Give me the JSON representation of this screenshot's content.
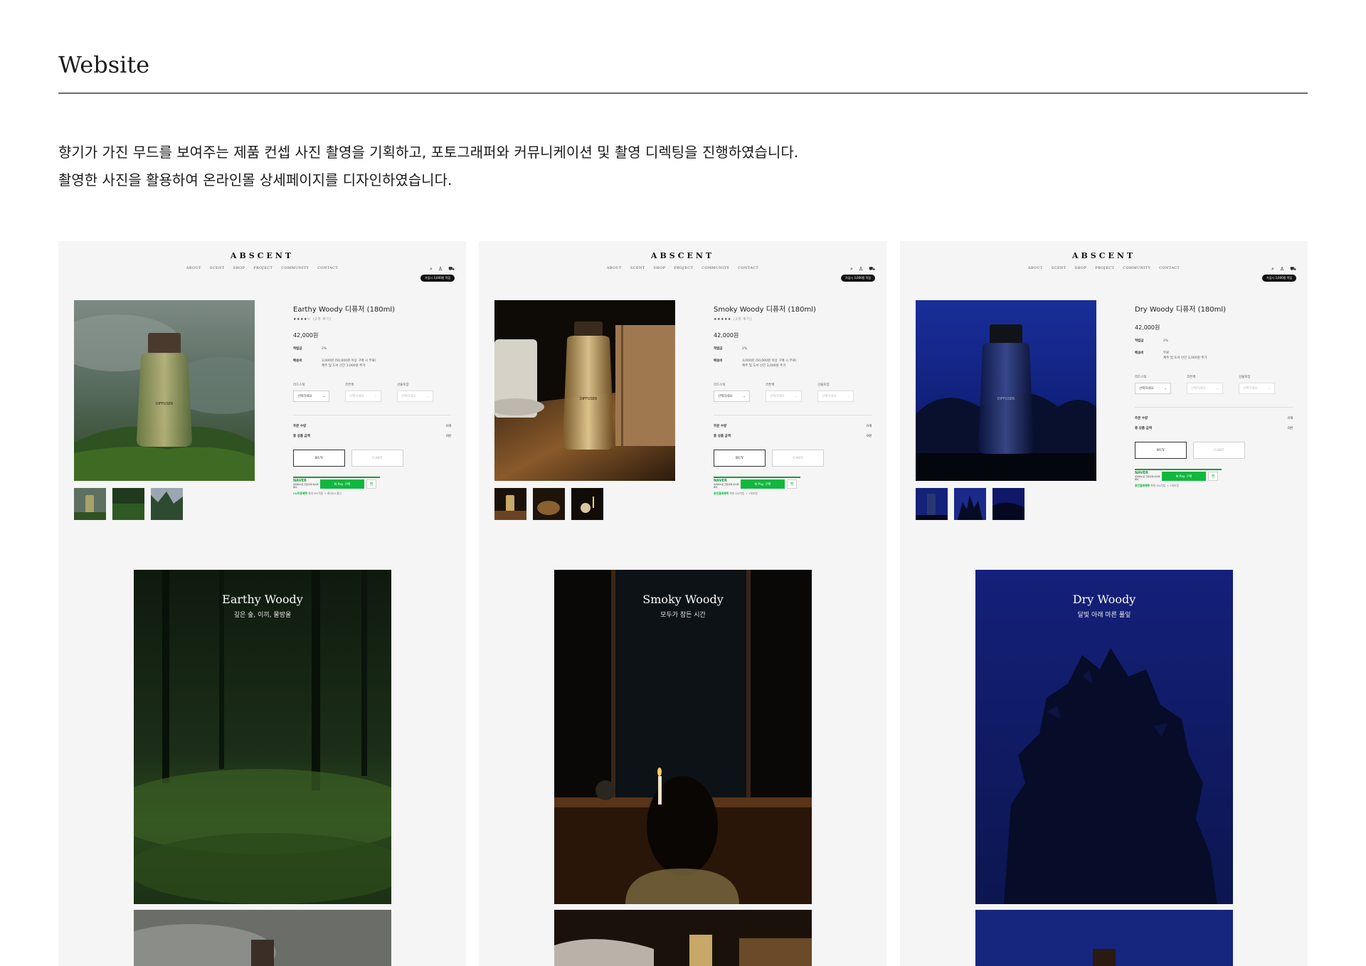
{
  "section": {
    "title": "Website",
    "description": [
      "향기가 가진 무드를 보여주는 제품 컨셉 사진 촬영을 기획하고, 포토그래퍼와 커뮤니케이션 및 촬영 디렉팅을 진행하였습니다.",
      "촬영한 사진을 활용하여 온라인몰 상세페이지를 디자인하였습니다."
    ]
  },
  "site": {
    "brand": "ABSCENT",
    "nav": [
      "ABOUT",
      "SCENT",
      "SHOP",
      "PROJECT",
      "COMMUNITY",
      "CONTACT"
    ],
    "util_icons": [
      "search-icon",
      "user-icon",
      "cart-icon"
    ],
    "util_badge": "가입시 3,000원 적립",
    "labels": {
      "points": "적립금",
      "shipping": "배송비",
      "opt_reed": "리드스틱",
      "opt_cotton": "코튼백",
      "opt_gift": "선물포장",
      "select": "선택하세요",
      "total_qty": "주문 수량",
      "total_price": "총 상품 금액",
      "buy": "BUY",
      "cart": "CART",
      "naver": "NAVER",
      "naver_sub": "네이버ID로 간편구매 네이버페이",
      "npay": "N Pay 구매",
      "zzim": "찜"
    }
  },
  "products": [
    {
      "name": "Earthy Woody 디퓨저 (180ml)",
      "stars": "★★★★☆",
      "review_note": "(2개 후기)",
      "price": "42,000원",
      "points": "2%",
      "shipping": "3,000원 (50,000원 이상 구매 시 무료)",
      "shipping2": "제주 및 도서 산간 3,000원 추가",
      "qty": "0개",
      "total": "0원",
      "npay_note_hl": "CU이용혜택",
      "npay_note": "최대 8%적립 + 최대5%결인",
      "detail_title": "Earthy Woody",
      "detail_sub": "깊은 숲, 이끼, 물방울",
      "accent": "#2f5a2a"
    },
    {
      "name": "Smoky Woody 디퓨저 (180ml)",
      "stars": "★★★★★",
      "review_note": "(2개 후기)",
      "price": "42,000원",
      "points": "2%",
      "shipping": "3,000원 (50,000원 이상 구매 시 무료)",
      "shipping2": "제주 및 도서 산간 3,000원 추가",
      "qty": "0개",
      "total": "0원",
      "npay_note_hl": "충전결제혜택",
      "npay_note": "최대 8%적립 + 1개포함",
      "detail_title": "Smoky Woody",
      "detail_sub": "모두가 잠든 시간",
      "accent": "#8a5a2a"
    },
    {
      "name": "Dry Woody 디퓨저 (180ml)",
      "stars": "",
      "review_note": "",
      "price": "42,000원",
      "points": "2%",
      "shipping": "무료",
      "shipping2": "제주 및 도서 산간 3,000원 추가",
      "qty": "0개",
      "total": "0원",
      "npay_note_hl": "충전결제혜택",
      "npay_note": "최대 8%적립 + 1개포함",
      "detail_title": "Dry Woody",
      "detail_sub": "달빛 아래 마른 풀잎",
      "accent": "#1a2a8a"
    }
  ]
}
